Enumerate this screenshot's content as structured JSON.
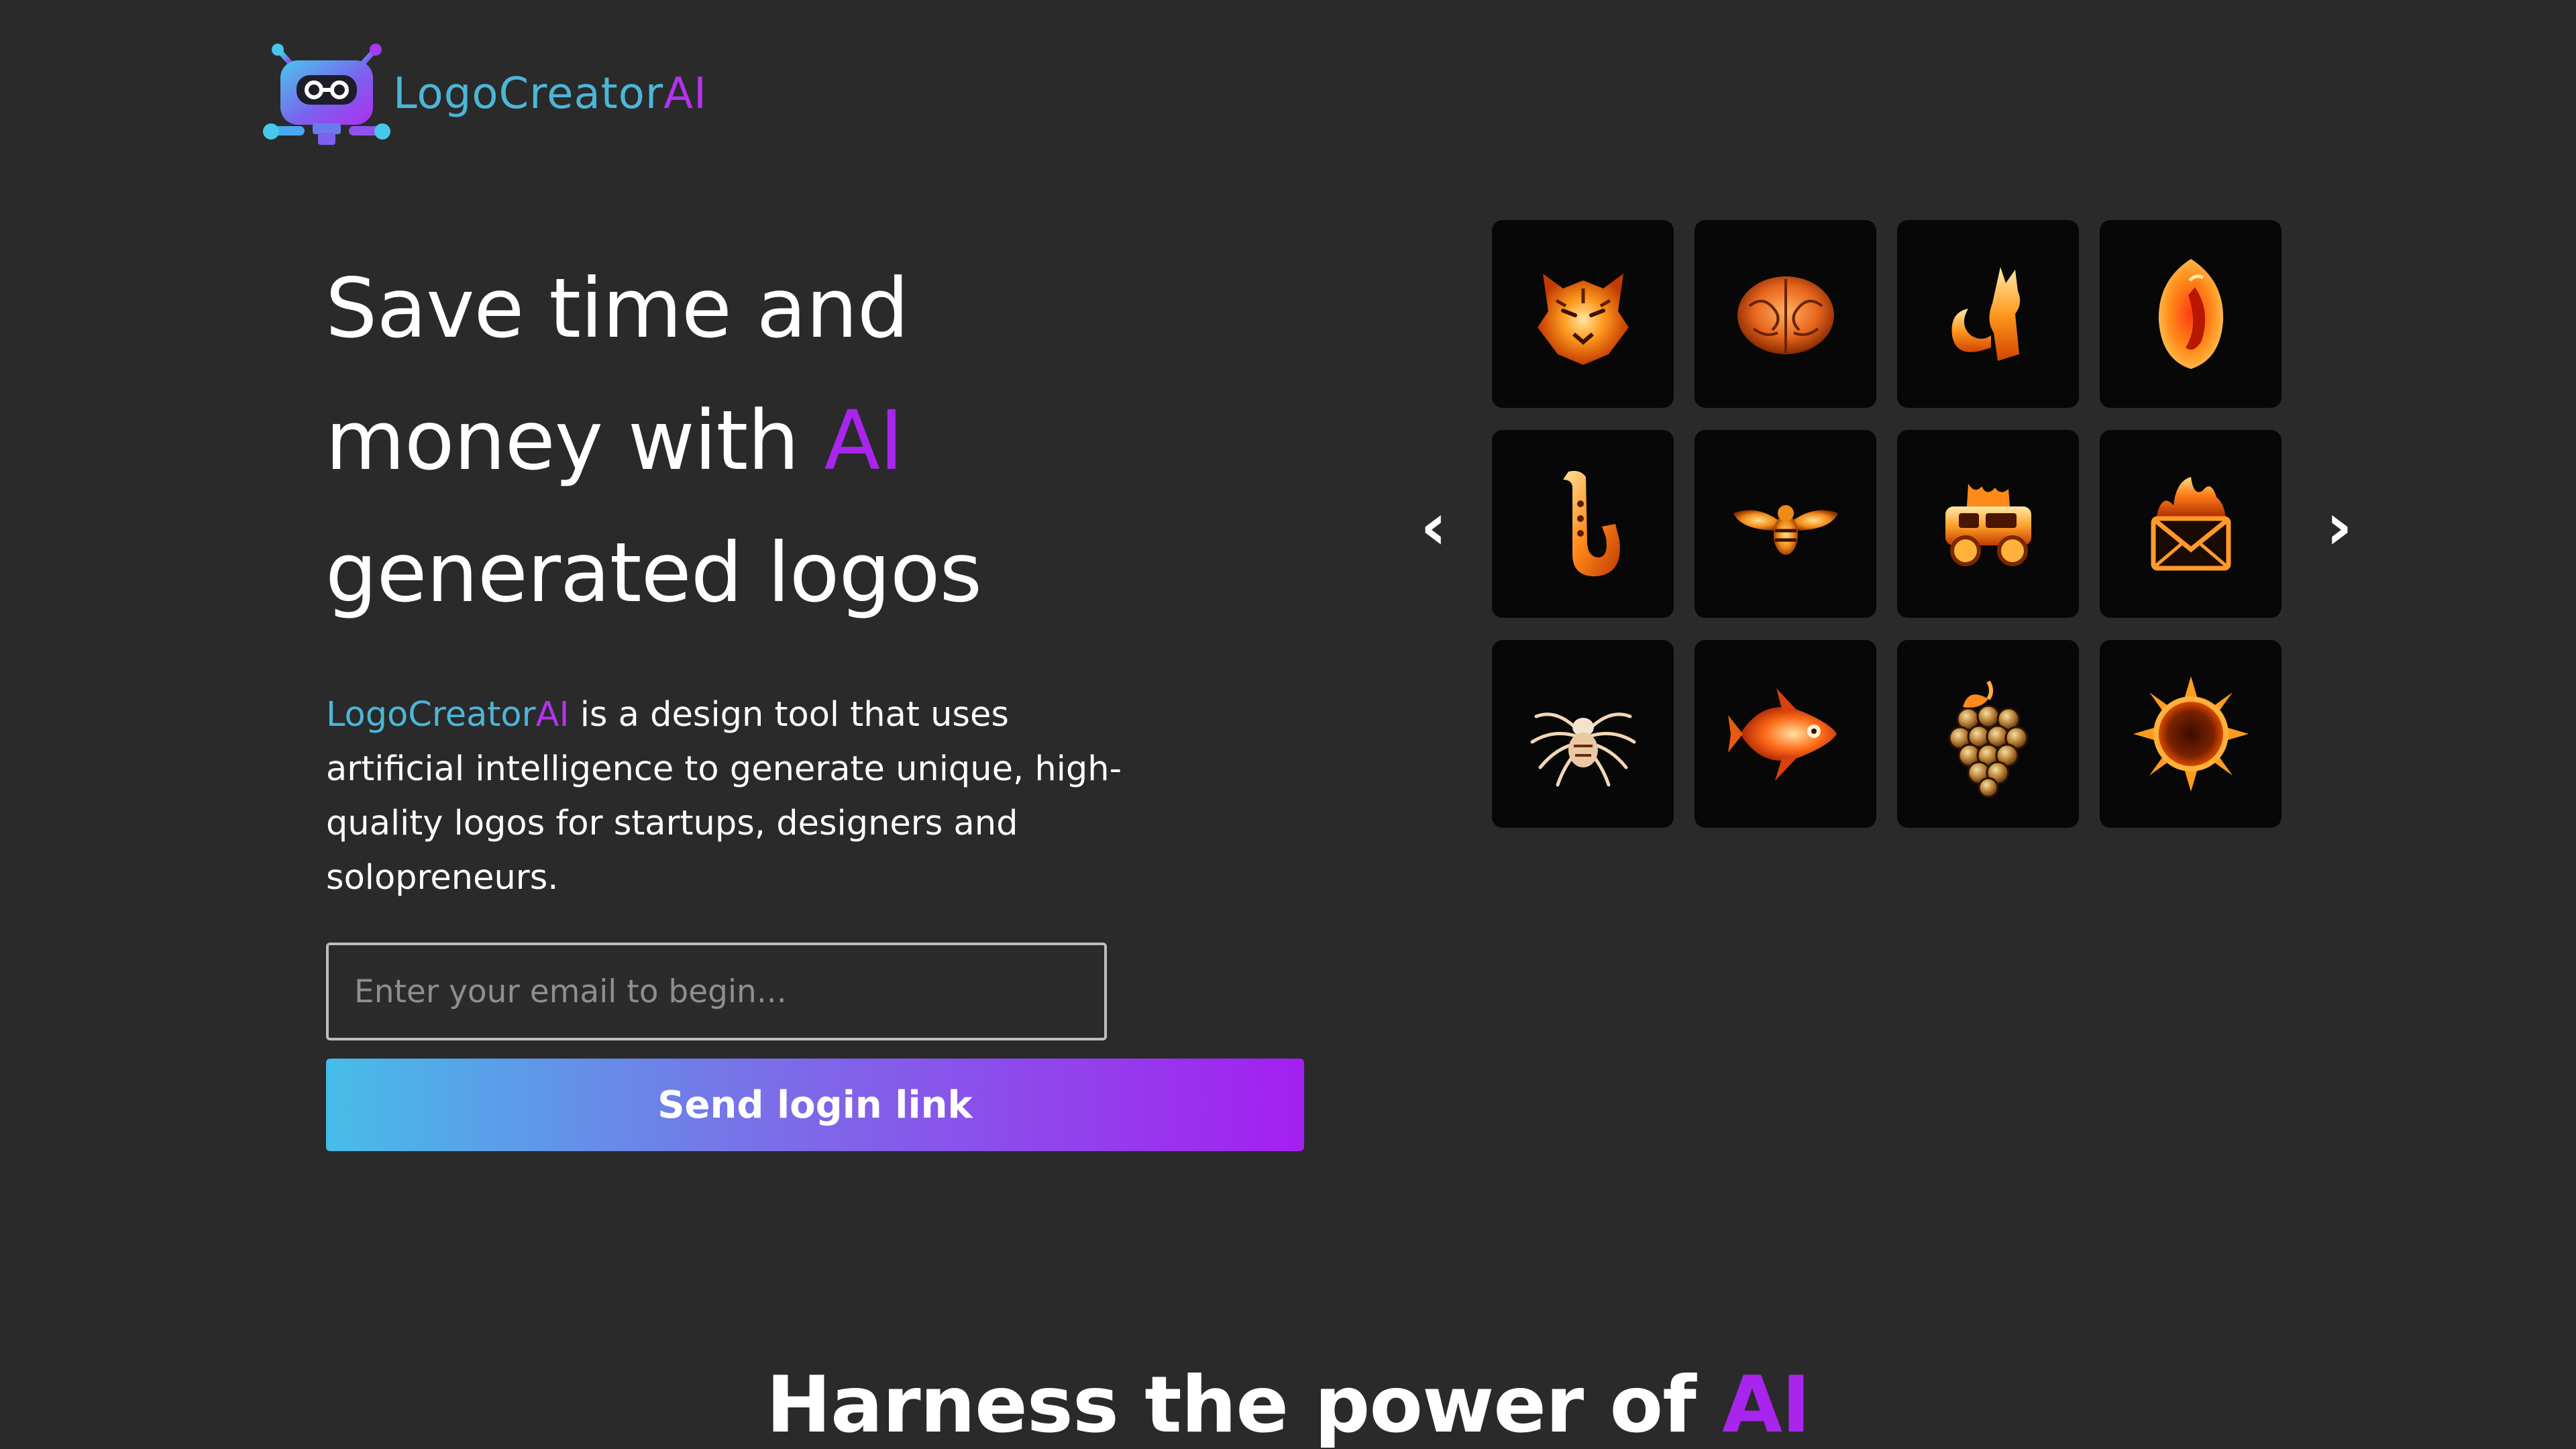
{
  "brand": {
    "name_part": "LogoCreator",
    "name_accent": "AI",
    "icon": "robot-icon"
  },
  "hero": {
    "headline_line1": "Save time and",
    "headline_line2_prefix": "money with",
    "headline_accent": "AI",
    "headline_line3": "generated logos",
    "description_brand": "LogoCreator",
    "description_brand_accent": "AI",
    "description_text": " is a design tool that uses artificial intelligence to generate unique, high-quality logos for startups, designers and solopreneurs."
  },
  "form": {
    "email_placeholder": "Enter your email to begin...",
    "email_value": "",
    "submit_label": "Send login link"
  },
  "carousel": {
    "prev_label": "‹",
    "next_label": "›",
    "logos": [
      {
        "icon": "fire-tiger-icon"
      },
      {
        "icon": "fire-brain-icon"
      },
      {
        "icon": "fire-fox-icon"
      },
      {
        "icon": "fire-chili-pepper-icon"
      },
      {
        "icon": "fire-saxophone-icon"
      },
      {
        "icon": "fire-bee-icon"
      },
      {
        "icon": "fire-truck-icon"
      },
      {
        "icon": "fire-envelope-icon"
      },
      {
        "icon": "fire-spider-icon"
      },
      {
        "icon": "fire-fish-icon"
      },
      {
        "icon": "fire-grapes-icon"
      },
      {
        "icon": "fire-sun-icon"
      }
    ]
  },
  "section": {
    "heading_prefix": "Harness the power of ",
    "heading_accent": "AI"
  },
  "colors": {
    "background": "#2a2a2b",
    "accent_purple": "#a925ee",
    "accent_cyan": "#4cb6d6",
    "tile_background": "#070707",
    "flame": "#ff8a1a"
  }
}
